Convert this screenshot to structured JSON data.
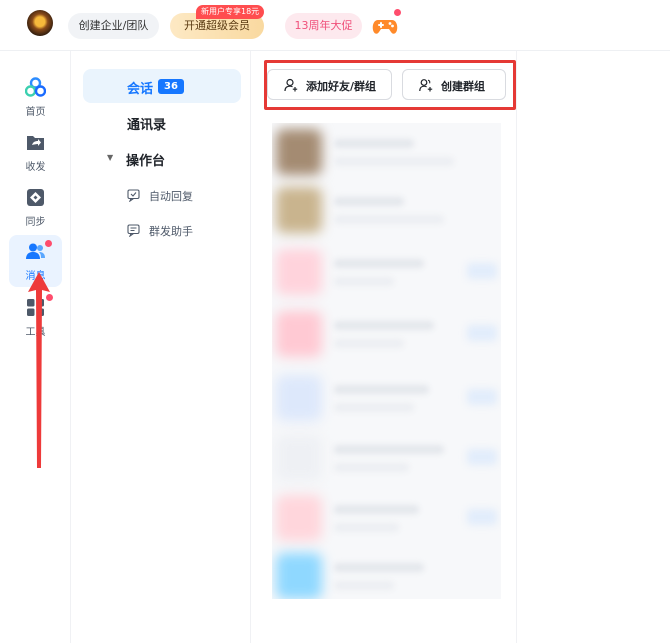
{
  "topbar": {
    "team_label": "创建企业/团队",
    "vip_label": "开通超级会员",
    "vip_badge": "新用户专享18元",
    "anniversary_label": "13周年大促"
  },
  "leftnav": {
    "items": [
      {
        "label": "首页",
        "icon": "home-icon"
      },
      {
        "label": "收发",
        "icon": "transfer-icon"
      },
      {
        "label": "同步",
        "icon": "sync-icon"
      },
      {
        "label": "消息",
        "icon": "users-icon",
        "active": true
      },
      {
        "label": "工具",
        "icon": "apps-icon"
      }
    ]
  },
  "subnav": {
    "conversation_label": "会话",
    "conversation_count": "36",
    "contacts_label": "通讯录",
    "workbench_label": "操作台",
    "auto_reply_label": "自动回复",
    "group_send_label": "群发助手"
  },
  "main": {
    "add_friend_label": "添加好友/群组",
    "create_group_label": "创建群组"
  },
  "colors": {
    "accent": "#1677ff",
    "highlight": "#e53935",
    "badge": "#ff4d4f"
  }
}
